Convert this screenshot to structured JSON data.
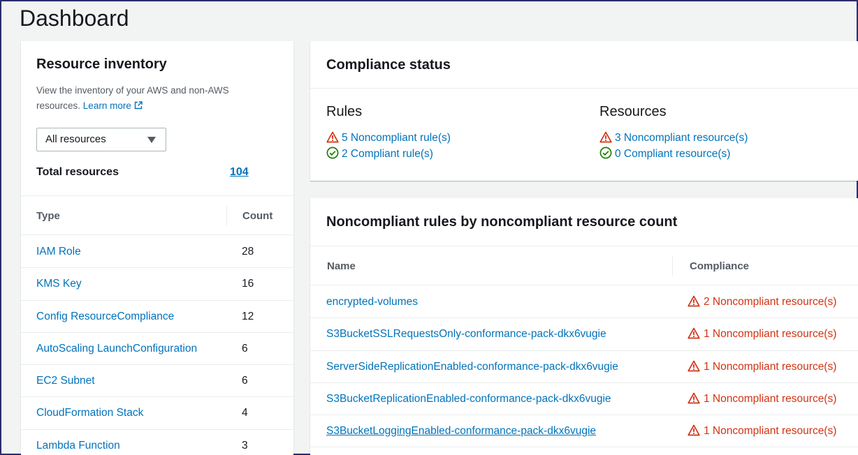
{
  "page": {
    "title": "Dashboard"
  },
  "colors": {
    "link": "#0073bb",
    "error": "#d13212",
    "success": "#1d8102",
    "text": "#16191f"
  },
  "inventory": {
    "title": "Resource inventory",
    "description": "View the inventory of your AWS and non-AWS resources.",
    "learn_more": "Learn more",
    "filter_value": "All resources",
    "total_label": "Total resources",
    "total_value": "104",
    "columns": {
      "type": "Type",
      "count": "Count"
    },
    "rows": [
      {
        "type": "IAM Role",
        "count": "28"
      },
      {
        "type": "KMS Key",
        "count": "16"
      },
      {
        "type": "Config ResourceCompliance",
        "count": "12"
      },
      {
        "type": "AutoScaling LaunchConfiguration",
        "count": "6"
      },
      {
        "type": "EC2 Subnet",
        "count": "6"
      },
      {
        "type": "CloudFormation Stack",
        "count": "4"
      },
      {
        "type": "Lambda Function",
        "count": "3"
      }
    ]
  },
  "compliance": {
    "title": "Compliance status",
    "rules": {
      "heading": "Rules",
      "noncompliant": "5 Noncompliant rule(s)",
      "compliant": "2 Compliant rule(s)"
    },
    "resources": {
      "heading": "Resources",
      "noncompliant": "3 Noncompliant resource(s)",
      "compliant": "0 Compliant resource(s)"
    }
  },
  "noncompliant_rules": {
    "title": "Noncompliant rules by noncompliant resource count",
    "columns": {
      "name": "Name",
      "compliance": "Compliance"
    },
    "rows": [
      {
        "name": "encrypted-volumes",
        "compliance": "2 Noncompliant resource(s)"
      },
      {
        "name": "S3BucketSSLRequestsOnly-conformance-pack-dkx6vugie",
        "compliance": "1 Noncompliant resource(s)"
      },
      {
        "name": "ServerSideReplicationEnabled-conformance-pack-dkx6vugie",
        "compliance": "1 Noncompliant resource(s)"
      },
      {
        "name": "S3BucketReplicationEnabled-conformance-pack-dkx6vugie",
        "compliance": "1 Noncompliant resource(s)"
      },
      {
        "name": "S3BucketLoggingEnabled-conformance-pack-dkx6vugie",
        "compliance": "1 Noncompliant resource(s)"
      }
    ]
  }
}
